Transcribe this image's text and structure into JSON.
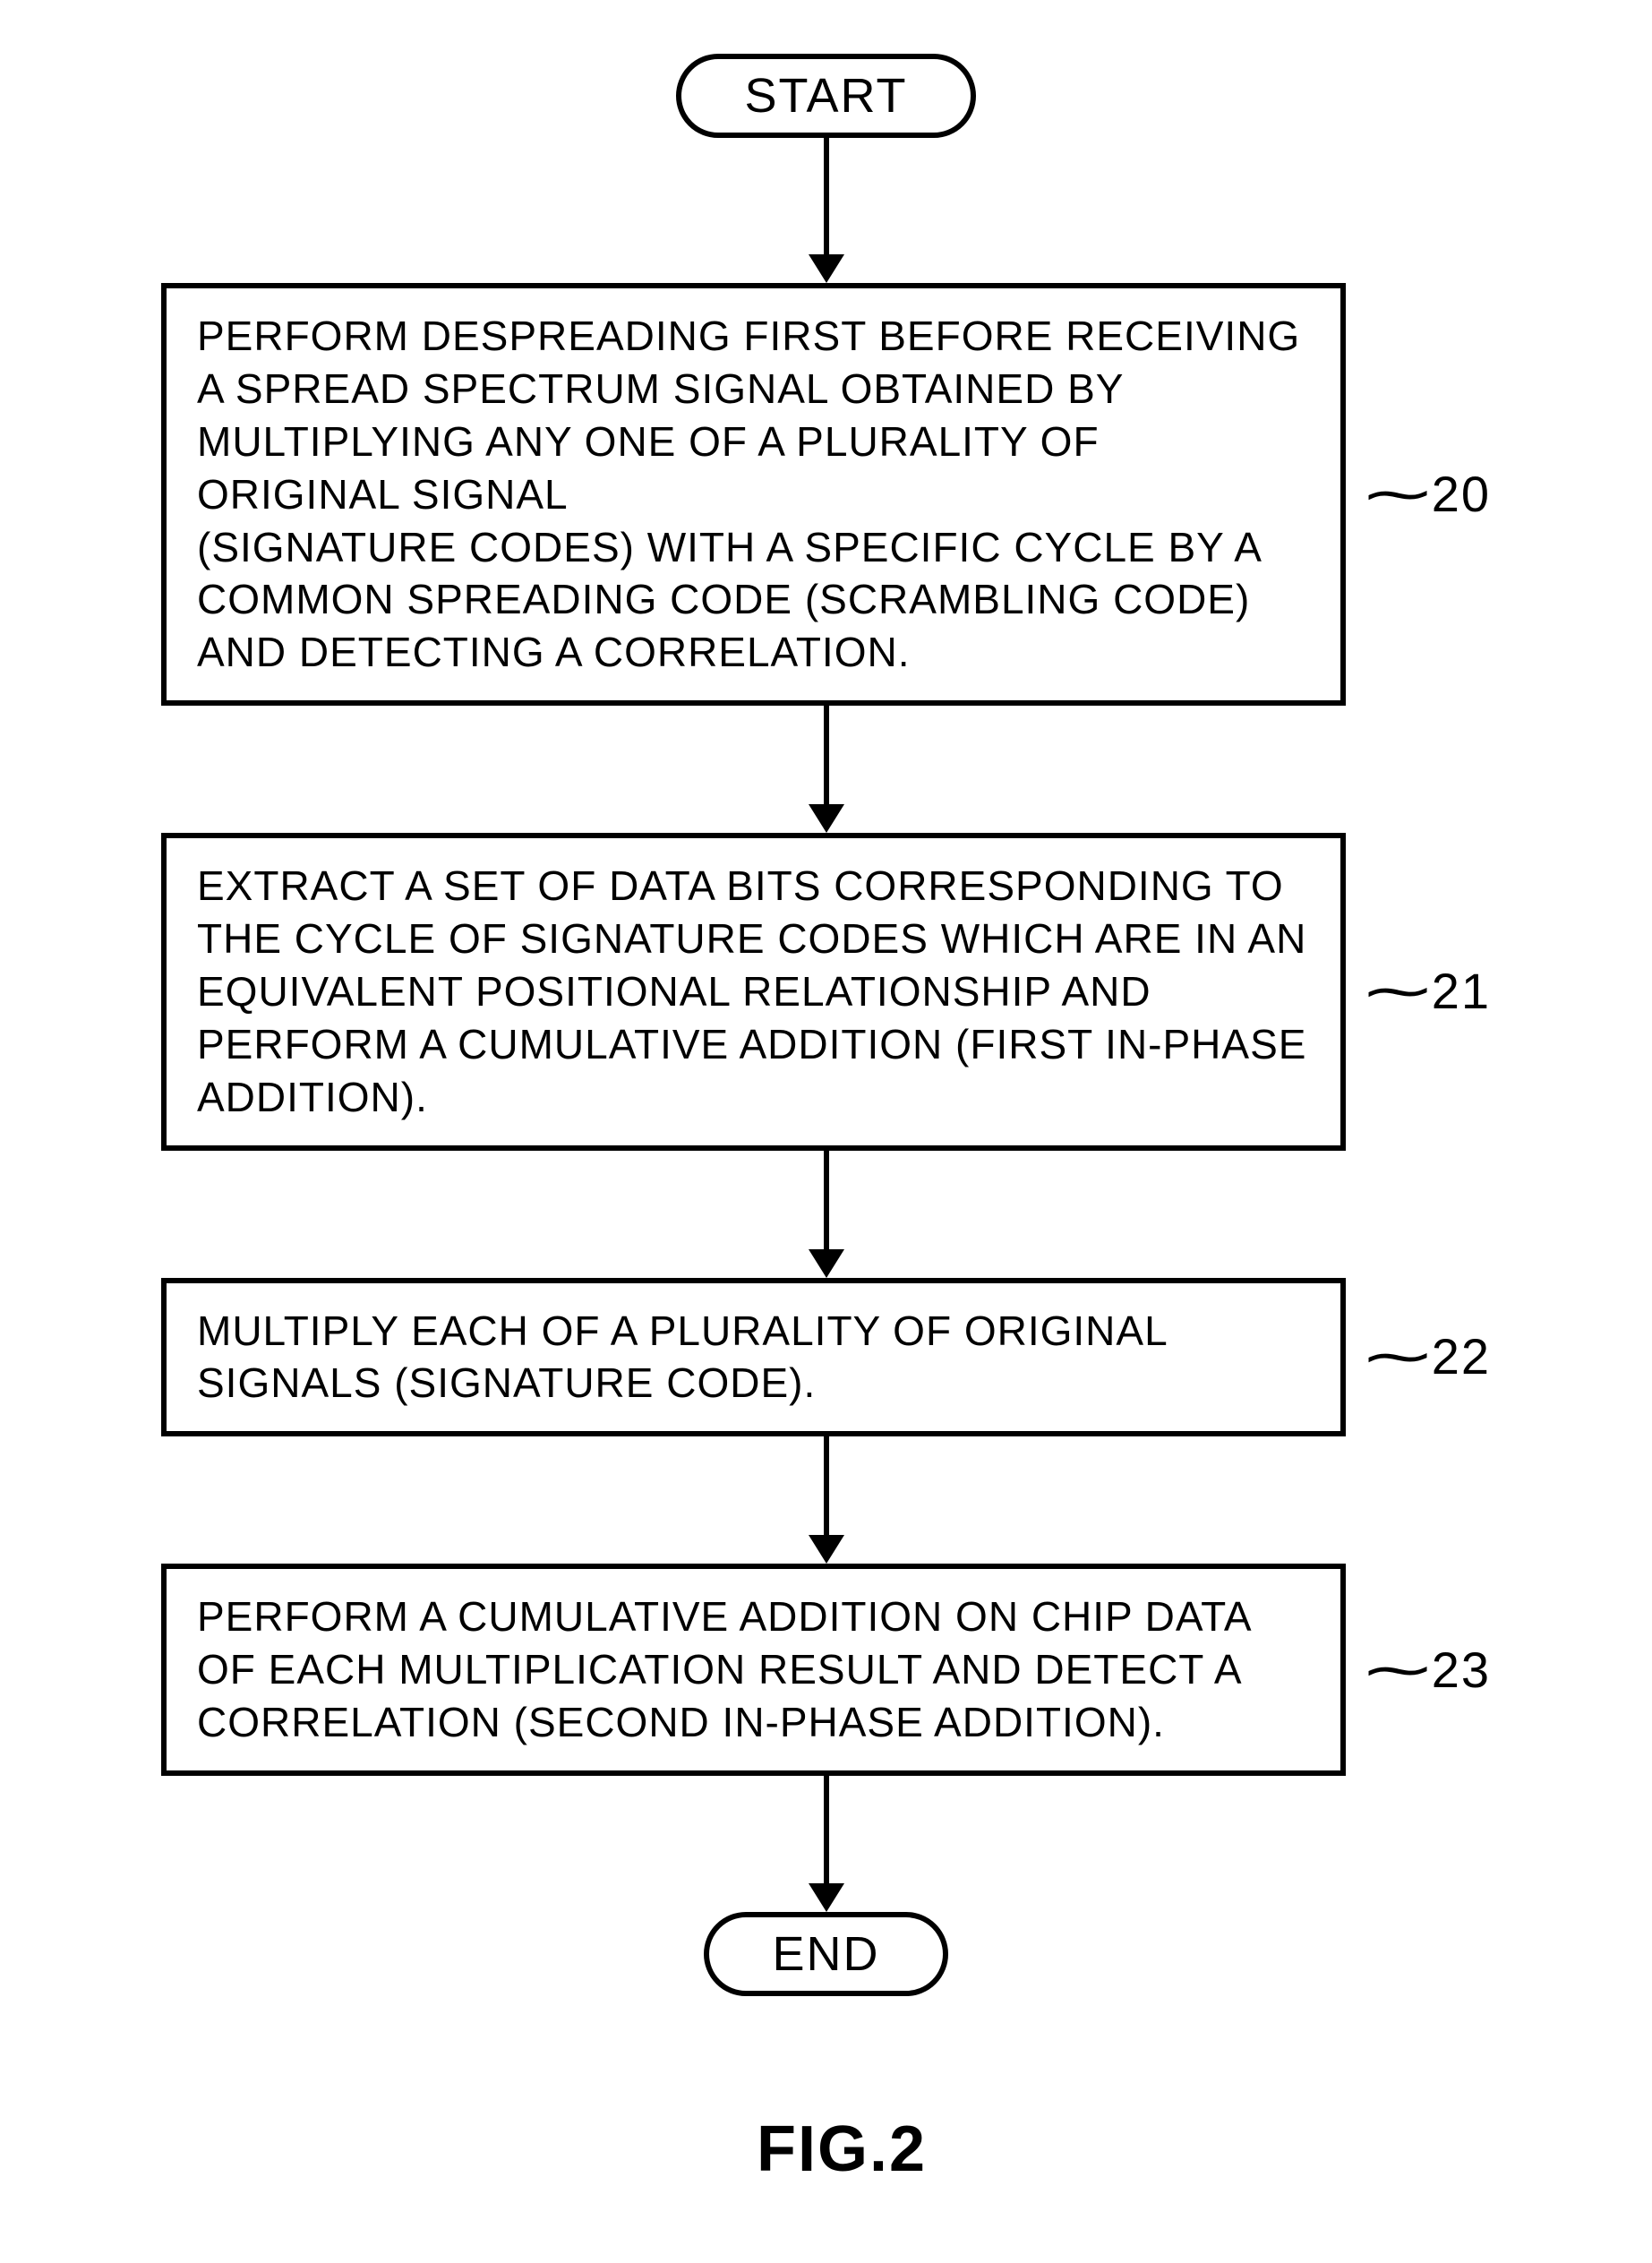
{
  "terminator": {
    "start": "START",
    "end": "END"
  },
  "steps": [
    {
      "id": "20",
      "text": "PERFORM DESPREADING FIRST BEFORE RECEIVING A SPREAD SPECTRUM SIGNAL OBTAINED BY MULTIPLYING ANY ONE OF A PLURALITY OF ORIGINAL SIGNAL\n(SIGNATURE CODES) WITH A SPECIFIC CYCLE BY A COMMON SPREADING CODE (SCRAMBLING CODE) AND DETECTING A CORRELATION."
    },
    {
      "id": "21",
      "text": "EXTRACT A SET OF DATA BITS CORRESPONDING TO THE CYCLE OF SIGNATURE CODES WHICH ARE IN AN EQUIVALENT POSITIONAL RELATIONSHIP AND PERFORM A CUMULATIVE ADDITION (FIRST IN-PHASE ADDITION)."
    },
    {
      "id": "22",
      "text": "MULTIPLY EACH OF A PLURALITY OF ORIGINAL SIGNALS (SIGNATURE CODE)."
    },
    {
      "id": "23",
      "text": "PERFORM A CUMULATIVE ADDITION ON CHIP DATA OF EACH MULTIPLICATION RESULT AND DETECT A CORRELATION (SECOND IN-PHASE ADDITION)."
    }
  ],
  "figure_caption": "FIG.2",
  "arrow_shaft_heights": {
    "after_start": 130,
    "between": 110,
    "before_end": 120
  }
}
